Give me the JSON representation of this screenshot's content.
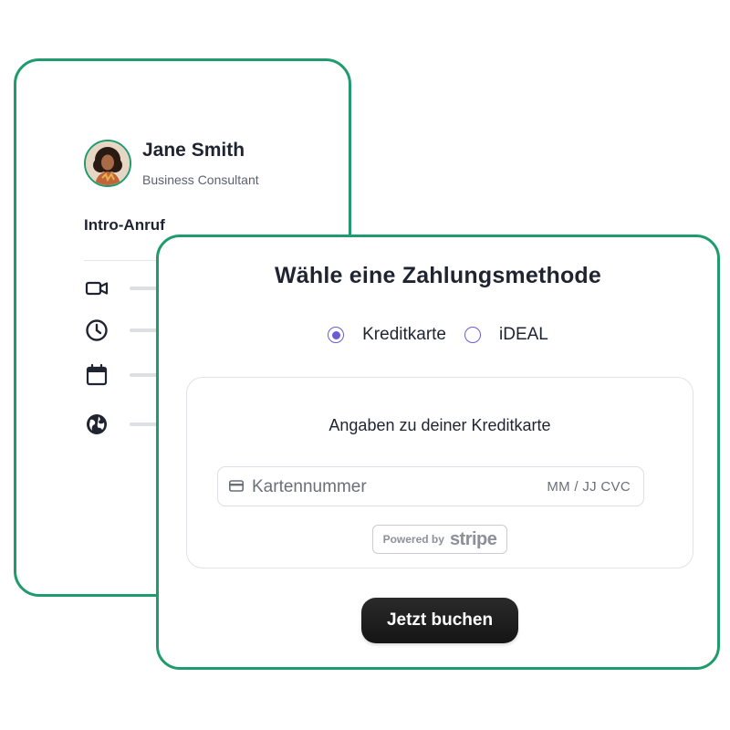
{
  "colors": {
    "accent_green": "#1f9b6e",
    "radio_purple": "#6b5bd6",
    "button_dark": "#1c1c1c"
  },
  "host": {
    "name": "Jane Smith",
    "role": "Business Consultant",
    "avatar_icon": "profile-photo"
  },
  "event": {
    "title": "Intro-Anruf",
    "details": [
      {
        "icon": "video-camera-icon"
      },
      {
        "icon": "clock-icon"
      },
      {
        "icon": "calendar-icon"
      },
      {
        "icon": "globe-icon"
      }
    ]
  },
  "payment": {
    "title": "Wähle eine Zahlungsmethode",
    "methods": [
      {
        "label": "Kreditkarte",
        "selected": true
      },
      {
        "label": "iDEAL",
        "selected": false
      }
    ],
    "card_section": {
      "title": "Angaben zu deiner Kreditkarte",
      "number_placeholder": "Kartennummer",
      "expiry_cvc_placeholder": "MM / JJ CVC",
      "card_icon": "credit-card-icon",
      "powered_by": "Powered by",
      "stripe": "stripe"
    },
    "book_button": "Jetzt buchen"
  }
}
